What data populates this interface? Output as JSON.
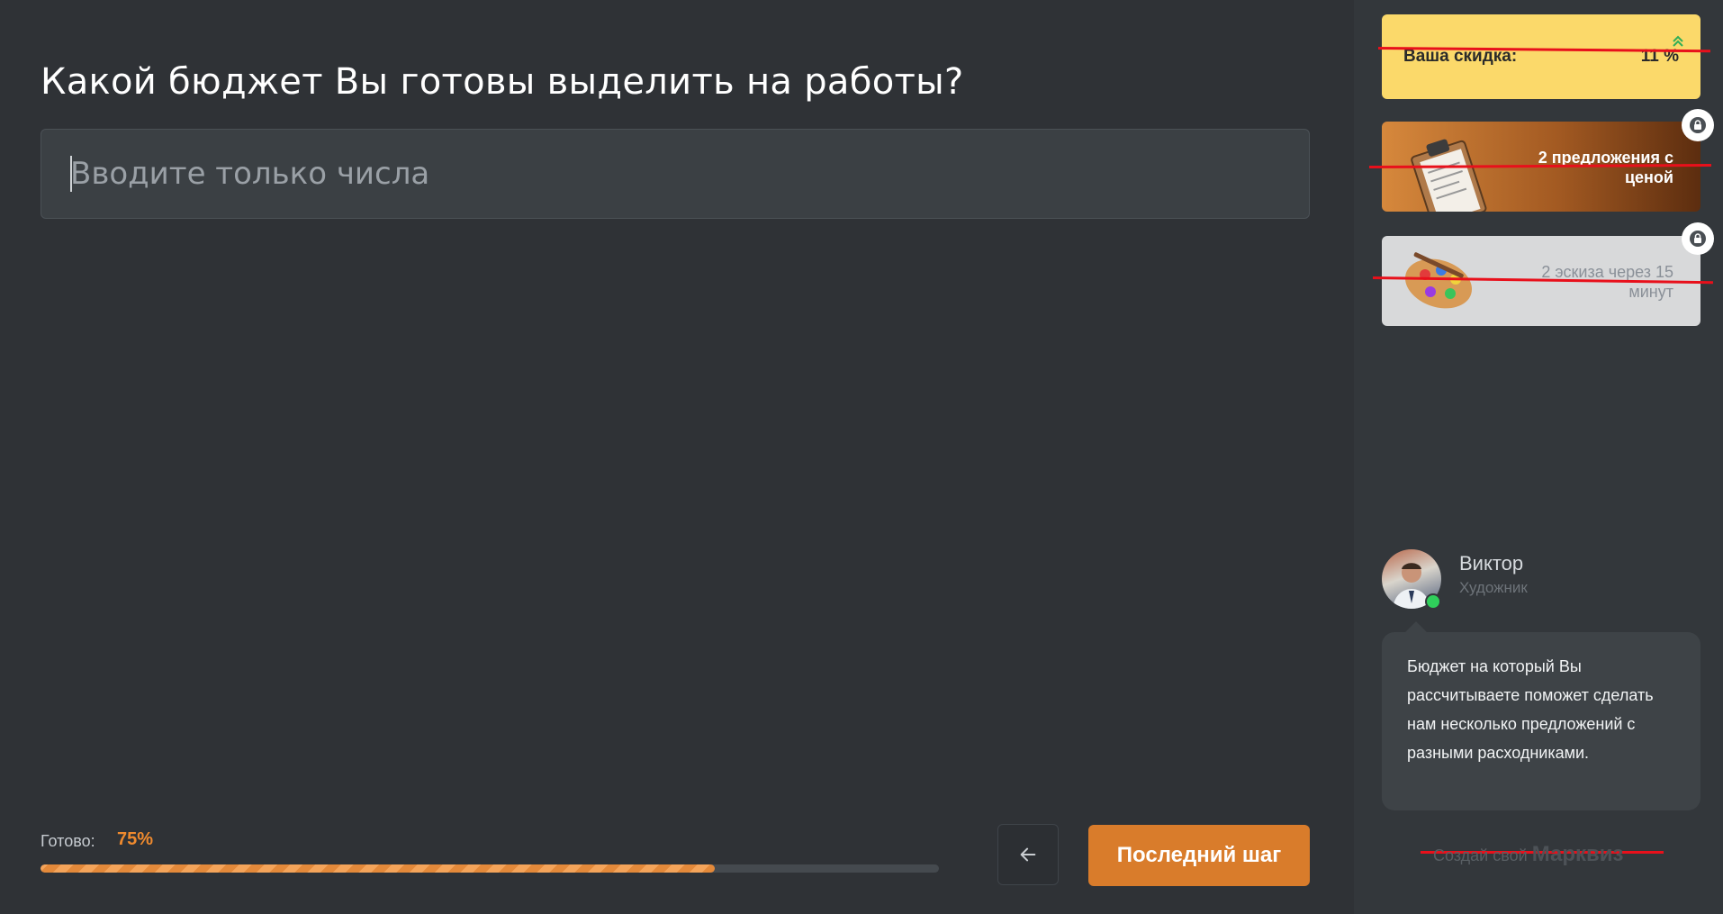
{
  "question": {
    "title": "Какой бюджет Вы готовы выделить на работы?",
    "placeholder": "Вводите только числа",
    "value": ""
  },
  "progress": {
    "label": "Готово:",
    "value_text": "75%",
    "percent": 75
  },
  "navigation": {
    "back_icon": "arrow-left-icon",
    "next_label": "Последний шаг"
  },
  "bonuses": {
    "discount": {
      "label": "Ваша скидка:",
      "value": "11 %",
      "trend_icon": "chevron-up-icon"
    },
    "items": [
      {
        "text": "2 предложения с ценой",
        "locked": true,
        "icon": "clipboard-icon"
      },
      {
        "text": "2 эскиза через 15 минут",
        "locked": true,
        "icon": "palette-icon"
      }
    ]
  },
  "consultant": {
    "name": "Виктор",
    "role": "Художник",
    "status": "online",
    "message": "Бюджет на который Вы рассчитываете поможет сделать нам несколько предложений с разными расходниками."
  },
  "branding": {
    "prefix": "Создай свой",
    "brand": "Марквиз"
  },
  "colors": {
    "background": "#2f3236",
    "sidebar": "#33373b",
    "accent": "#d97c2b",
    "discount_card": "#fbd96a",
    "online": "#2fcf5b",
    "annotation_red": "#e8101b"
  }
}
